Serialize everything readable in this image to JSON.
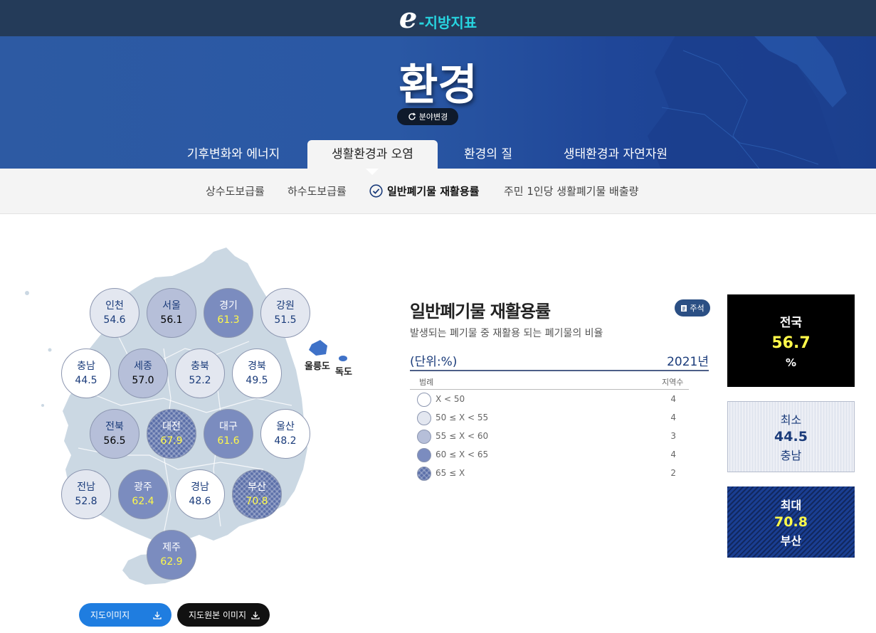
{
  "logo": {
    "mark": "e",
    "text": "-지방지표"
  },
  "hero": {
    "title": "환경",
    "field_change": "분야변경"
  },
  "tabs": [
    {
      "label": "기후변화와 에너지"
    },
    {
      "label": "생활환경과 오염"
    },
    {
      "label": "환경의 질"
    },
    {
      "label": "생태환경과 자연자원"
    }
  ],
  "subnav": [
    {
      "label": "상수도보급률"
    },
    {
      "label": "하수도보급률"
    },
    {
      "label": "일반폐기물 재활용률"
    },
    {
      "label": "주민 1인당 생활폐기물 배출량"
    }
  ],
  "map": {
    "regions": [
      {
        "name": "인천",
        "value": "54.6",
        "level": 2
      },
      {
        "name": "서울",
        "value": "56.1",
        "level": 3
      },
      {
        "name": "경기",
        "value": "61.3",
        "level": 4
      },
      {
        "name": "강원",
        "value": "51.5",
        "level": 2
      },
      {
        "name": "충남",
        "value": "44.5",
        "level": 1
      },
      {
        "name": "세종",
        "value": "57.0",
        "level": 3
      },
      {
        "name": "충북",
        "value": "52.2",
        "level": 2
      },
      {
        "name": "경북",
        "value": "49.5",
        "level": 1
      },
      {
        "name": "전북",
        "value": "56.5",
        "level": 3
      },
      {
        "name": "대전",
        "value": "67.9",
        "level": 5
      },
      {
        "name": "대구",
        "value": "61.6",
        "level": 4
      },
      {
        "name": "울산",
        "value": "48.2",
        "level": 1
      },
      {
        "name": "전남",
        "value": "52.8",
        "level": 2
      },
      {
        "name": "광주",
        "value": "62.4",
        "level": 4
      },
      {
        "name": "경남",
        "value": "48.6",
        "level": 1
      },
      {
        "name": "부산",
        "value": "70.8",
        "level": 5
      },
      {
        "name": "제주",
        "value": "62.9",
        "level": 4
      }
    ],
    "islands": {
      "ulleung": "울릉도",
      "dokdo": "독도"
    },
    "buttons": {
      "map_image": "지도이미지",
      "original_image": "지도원본 이미지"
    }
  },
  "info": {
    "title": "일반폐기물 재활용률",
    "note": "주석",
    "description": "발생되는 폐기물 중 재활용 되는 폐기물의 비율",
    "unit": "(단위:%)",
    "year": "2021년",
    "legend_header": "범례",
    "count_header": "지역수",
    "legend": [
      {
        "label": "X < 50",
        "count": "4"
      },
      {
        "label": "50 ≤ X < 55",
        "count": "4"
      },
      {
        "label": "55 ≤ X < 60",
        "count": "3"
      },
      {
        "label": "60 ≤ X < 65",
        "count": "4"
      },
      {
        "label": "65 ≤ X",
        "count": "2"
      }
    ]
  },
  "stats": {
    "national": {
      "label": "전국",
      "value": "56.7",
      "unit": "%"
    },
    "min": {
      "label": "최소",
      "value": "44.5",
      "region": "충남"
    },
    "max": {
      "label": "최대",
      "value": "70.8",
      "region": "부산"
    }
  },
  "colors": {
    "topbar": "#243b59",
    "hero": "#2a58a4",
    "logo_accent": "#27d4e0",
    "level1": "#ffffff",
    "level2": "#e3e7f0",
    "level3": "#b6bfd9",
    "level4": "#7b8cbf",
    "level5": "#5a6ea8",
    "highlight_value": "#fff94a"
  }
}
